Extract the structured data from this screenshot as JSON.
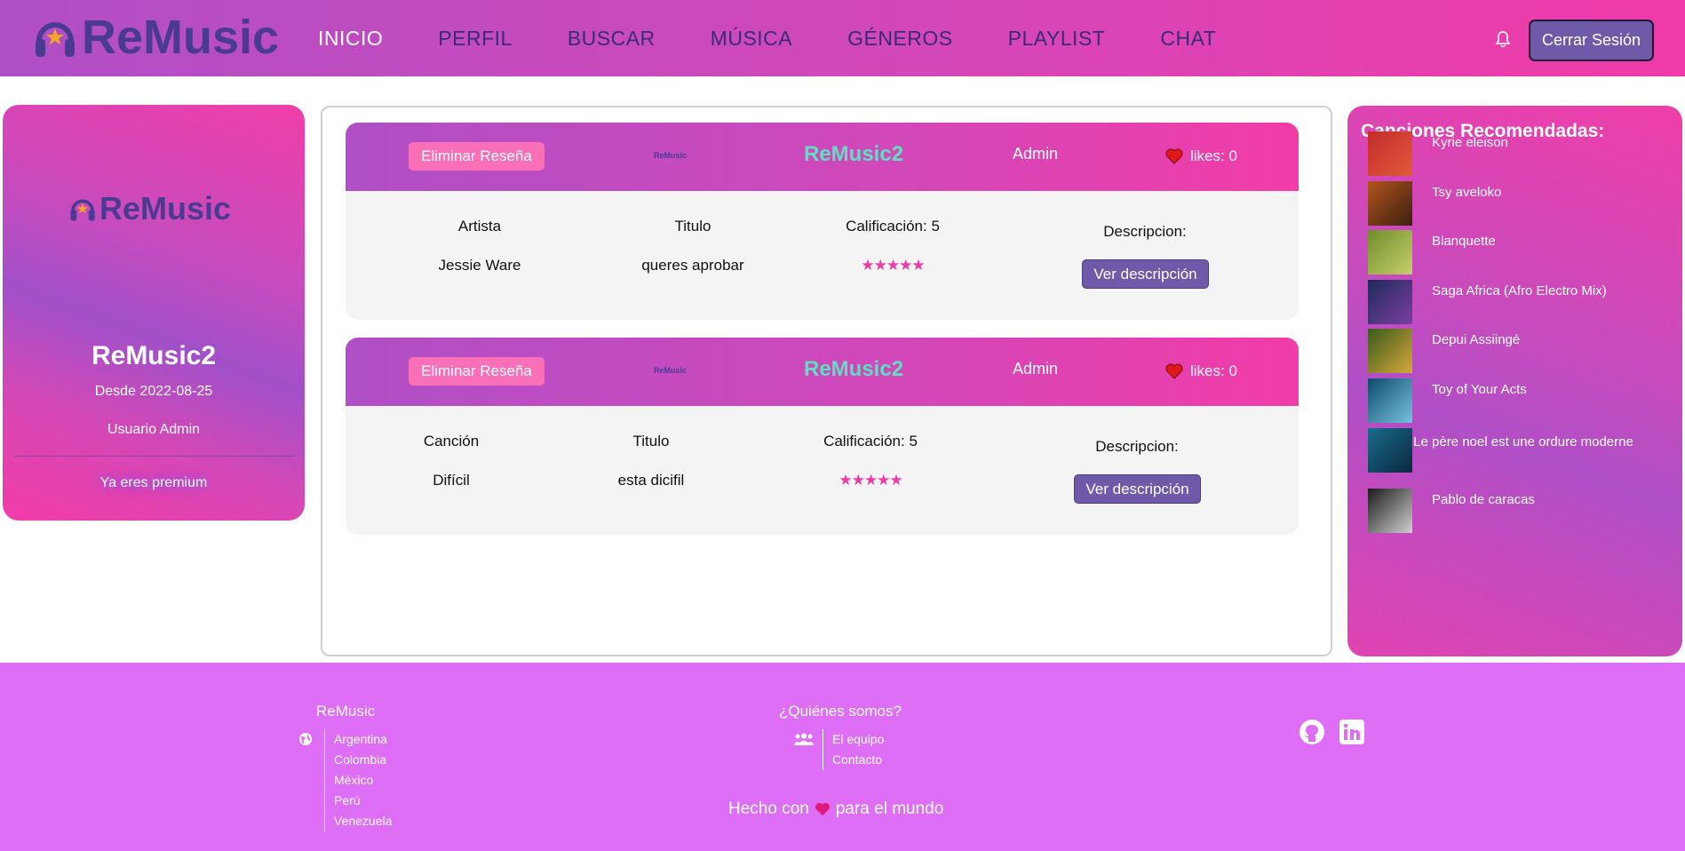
{
  "brand": {
    "name": "ReMusic"
  },
  "nav": {
    "items": [
      {
        "label": "INICIO",
        "active": true
      },
      {
        "label": "PERFIL",
        "active": false
      },
      {
        "label": "BUSCAR",
        "active": false
      },
      {
        "label": "MÚSICA",
        "active": false
      },
      {
        "label": "GÉNEROS",
        "active": false
      },
      {
        "label": "PLAYLIST",
        "active": false
      },
      {
        "label": "CHAT",
        "active": false
      }
    ],
    "logout_label": "Cerrar Sesión",
    "bell_icon": "bell-icon"
  },
  "profile": {
    "logo_text": "ReMusic",
    "name": "ReMusic2",
    "since": "Desde 2022-08-25",
    "role": "Usuario Admin",
    "premium": "Ya eres premium"
  },
  "reviews": [
    {
      "delete_label": "Eliminar Reseña",
      "mini_logo": "ReMusic",
      "user": "ReMusic2",
      "role": "Admin",
      "likes": "likes: 0",
      "col1_label": "Artista",
      "col1_value": "Jessie Ware",
      "col2_label": "Titulo",
      "col2_value": "queres aprobar",
      "rating_label": "Calificación: 5",
      "stars": "★★★★★",
      "desc_label": "Descripcion:",
      "desc_button": "Ver descripción"
    },
    {
      "delete_label": "Eliminar Reseña",
      "mini_logo": "ReMusic",
      "user": "ReMusic2",
      "role": "Admin",
      "likes": "likes: 0",
      "col1_label": "Canción",
      "col1_value": "Difícil",
      "col2_label": "Titulo",
      "col2_value": "esta dicifil",
      "rating_label": "Calificación: 5",
      "stars": "★★★★★",
      "desc_label": "Descripcion:",
      "desc_button": "Ver descripción"
    }
  ],
  "recommendations": {
    "title": "Canciones Recomendadas:",
    "items": [
      {
        "title": "Kyrie eleison",
        "colors": [
          "#c42b2b",
          "#e05a3a"
        ]
      },
      {
        "title": "Tsy aveloko",
        "colors": [
          "#b3541e",
          "#3a2010"
        ]
      },
      {
        "title": "Blanquette",
        "colors": [
          "#6f8d2a",
          "#c5d06a"
        ]
      },
      {
        "title": "Saga Africa (Afro Electro Mix)",
        "colors": [
          "#1f2a5a",
          "#7b3fa0"
        ]
      },
      {
        "title": "Depui Assiingé",
        "colors": [
          "#3a5a1c",
          "#d6a83a"
        ]
      },
      {
        "title": "Toy of Your Acts",
        "colors": [
          "#0d4a6a",
          "#78c2e0"
        ]
      },
      {
        "title": "Le père noel est une ordure moderne",
        "colors": [
          "#1a6a8a",
          "#0a2a40"
        ]
      },
      {
        "title": "Pablo de caracas",
        "colors": [
          "#1a1a1a",
          "#d0d0d0"
        ]
      }
    ]
  },
  "footer": {
    "col1_title": "ReMusic",
    "countries": [
      "Argentina",
      "Colombia",
      "México",
      "Perú",
      "Venezuela"
    ],
    "col2_title": "¿Quiénes somos?",
    "about": [
      "El equipo",
      "Contacto"
    ],
    "made_before": "Hecho con",
    "made_after": "para el mundo",
    "github_icon": "github-icon",
    "linkedin_icon": "linkedin-icon"
  }
}
